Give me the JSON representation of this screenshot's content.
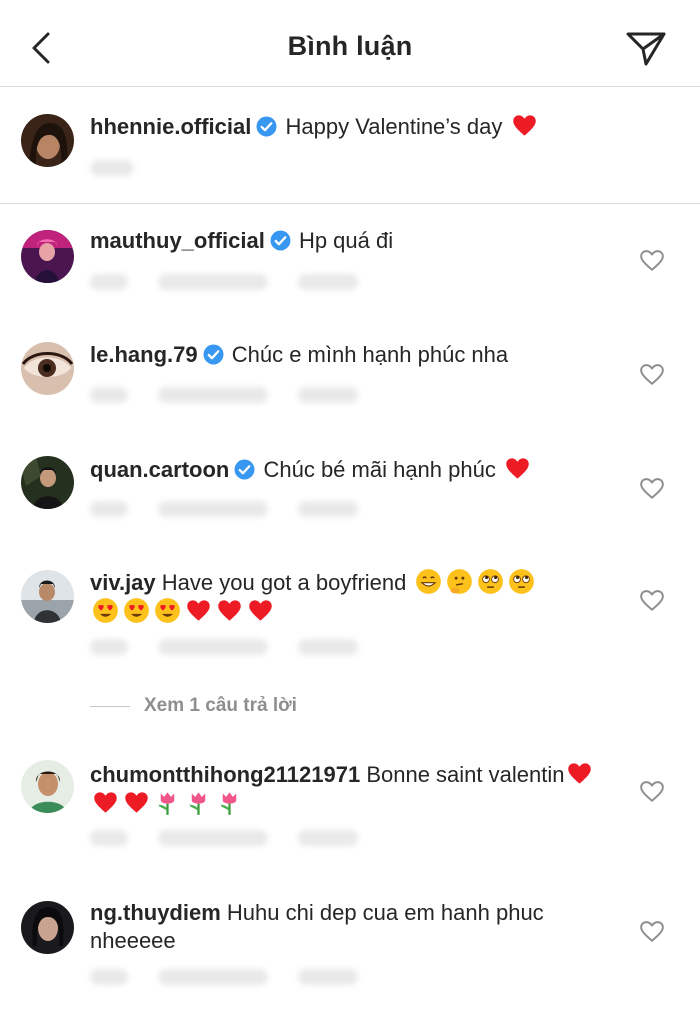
{
  "header": {
    "title": "Bình luận",
    "back_icon": "chevron-left-icon",
    "send_icon": "paper-plane-icon"
  },
  "caption": {
    "username": "hhennie.official",
    "text": "Happy Valentine’s day",
    "verified": true
  },
  "comments": [
    {
      "username": "mauthuy_official",
      "text": "Hp quá đi",
      "verified": true
    },
    {
      "username": "le.hang.79",
      "text": "Chúc e mình hạnh phúc nha",
      "verified": true
    },
    {
      "username": "quan.cartoon",
      "text": "Chúc bé mãi hạnh phúc",
      "verified": true
    },
    {
      "username": "viv.jay",
      "text": "Have you got a boyfriend",
      "verified": false
    },
    {
      "username": "chumontthihong21121971",
      "text": "Bonne saint valentin",
      "verified": false
    },
    {
      "username": "ng.thuydiem",
      "text": "Huhu chi dep cua em hanh phuc nheeeee",
      "verified": false
    }
  ],
  "view_replies": {
    "label": "Xem 1 câu trả lời"
  },
  "colors": {
    "verified_badge": "#3897f0",
    "heart_emoji": "#ed1c24",
    "divider": "#dbdbdb",
    "muted_text": "#8e8e8e"
  }
}
